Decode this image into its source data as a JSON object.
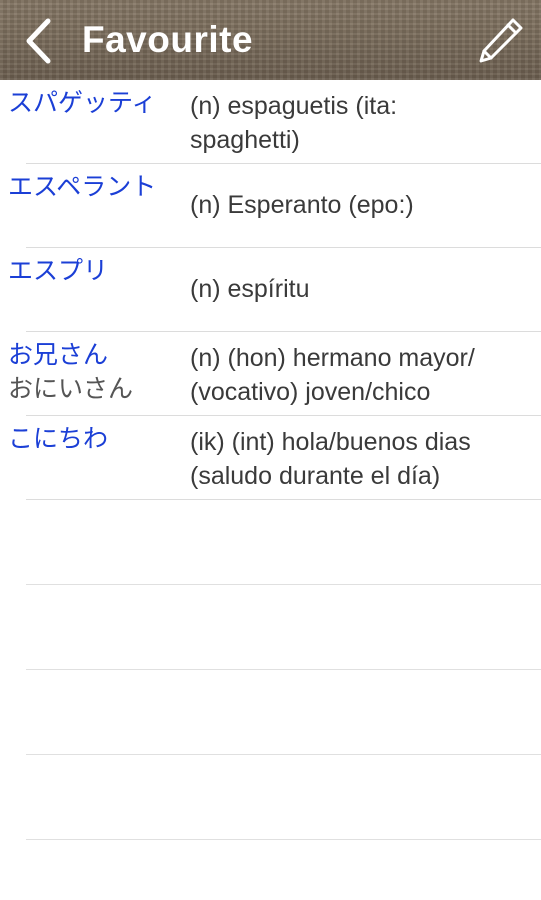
{
  "navbar": {
    "title": "Favourite",
    "back_icon": "chevron-left-icon",
    "edit_icon": "pencil-icon",
    "text_color": "#ffffff"
  },
  "entries": [
    {
      "word": "スパゲッティ",
      "reading": "",
      "meaning": "(n) espaguetis (ita:\nspaghetti)"
    },
    {
      "word": "エスペラント",
      "reading": "",
      "meaning": "(n) Esperanto (epo:)"
    },
    {
      "word": "エスプリ",
      "reading": "",
      "meaning": "(n) espíritu"
    },
    {
      "word": "お兄さん",
      "reading": "おにいさん",
      "meaning": "(n) (hon) hermano mayor/\n(vocativo) joven/chico"
    },
    {
      "word": "こにちわ",
      "reading": "",
      "meaning": "(ik) (int) hola/buenos dias\n(saludo durante el día)"
    }
  ],
  "colors": {
    "word": "#1b3fd6",
    "reading": "#555555",
    "meaning": "#3a3a3a",
    "separator": "#dcdcdc"
  }
}
